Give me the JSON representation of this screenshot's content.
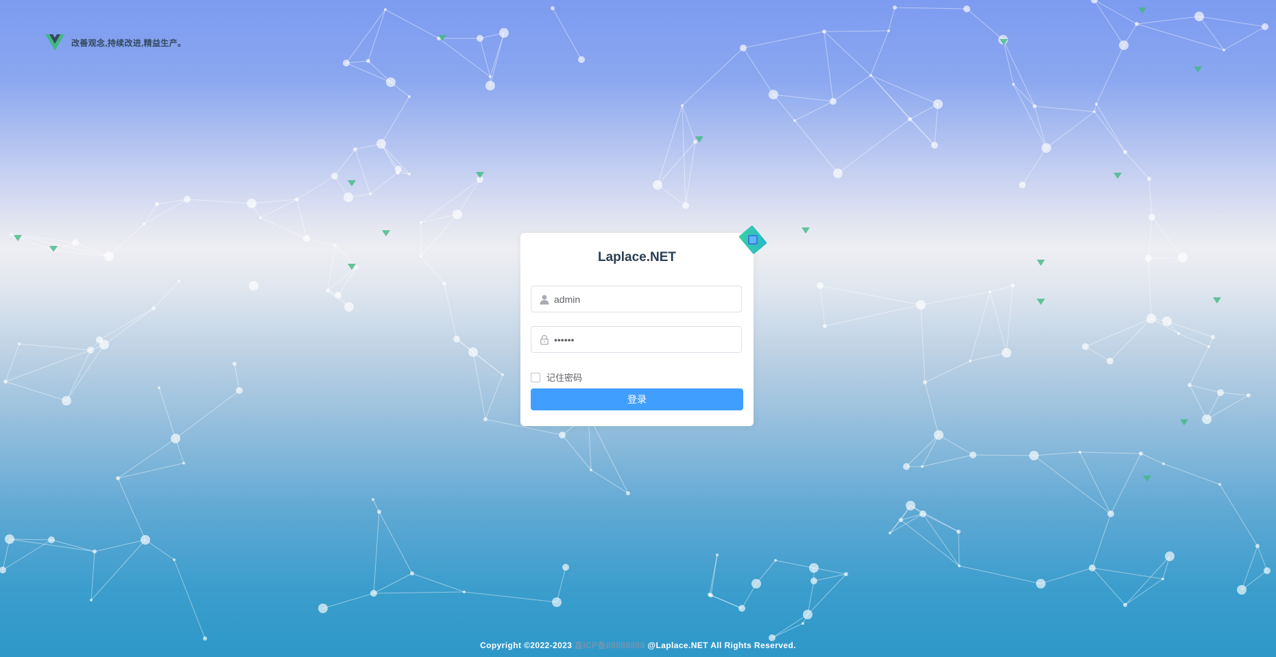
{
  "brand": {
    "logo_icon": "vue-logo-icon",
    "slogan": "改善观念,持续改进,精益生产。"
  },
  "login": {
    "title": "Laplace.NET",
    "username": {
      "value": "admin",
      "icon": "user-icon"
    },
    "password": {
      "value": "••••••",
      "icon": "lock-icon"
    },
    "remember_label": "记住密码",
    "submit_label": "登录"
  },
  "footer": {
    "copyright": "Copyright ©2022-2023",
    "icp": "鑫ICP备88888888",
    "rights": "@Laplace.NET All Rights Reserved."
  },
  "colors": {
    "primary": "#409eff",
    "brand_green": "#41b883",
    "brand_dark": "#35495e"
  }
}
